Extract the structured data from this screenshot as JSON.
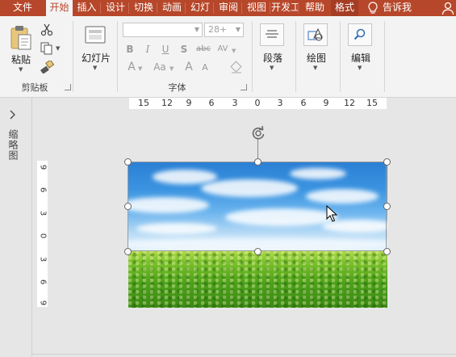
{
  "tabs": [
    {
      "label": "文件",
      "active": false
    },
    {
      "label": "开始",
      "active": true
    },
    {
      "label": "插入",
      "active": false
    },
    {
      "label": "设计",
      "active": false
    },
    {
      "label": "切换",
      "active": false
    },
    {
      "label": "动画",
      "active": false
    },
    {
      "label": "幻灯",
      "active": false
    },
    {
      "label": "审阅",
      "active": false
    },
    {
      "label": "视图",
      "active": false
    },
    {
      "label": "开发工",
      "active": false
    },
    {
      "label": "帮助",
      "active": false
    },
    {
      "label": "格式",
      "active": false
    },
    {
      "label": "告诉我",
      "active": false
    }
  ],
  "ribbon": {
    "clipboard": {
      "paste_label": "粘贴",
      "group_label": "剪贴板"
    },
    "slides": {
      "new_slide_label": "幻灯片"
    },
    "font": {
      "font_name_value": "",
      "font_size_value": "28+",
      "format_buttons": [
        "B",
        "I",
        "U",
        "S",
        "abc",
        "AV"
      ],
      "row3_buttons": [
        "A",
        "Aa",
        "A",
        "A"
      ],
      "group_label": "字体"
    },
    "paragraph_label": "段落",
    "drawing_label": "绘图",
    "editing_label": "编辑"
  },
  "left_pane": {
    "thumbnail_label": "缩略图"
  },
  "hruler_ticks": [
    "15",
    "12",
    "9",
    "6",
    "3",
    "0",
    "3",
    "6",
    "9",
    "12",
    "15"
  ],
  "vruler_ticks": [
    "9",
    "6",
    "3",
    "0",
    "3",
    "6",
    "9"
  ],
  "colors": {
    "accent": "#b7472a",
    "ribbon_bg": "#f3f3f3",
    "workspace_bg": "#e6e6e6"
  }
}
